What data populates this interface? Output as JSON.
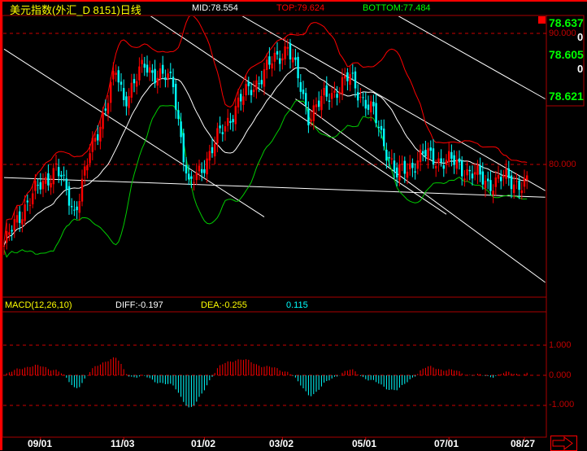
{
  "header": {
    "title": "美元指数(外汇_D 8151)日线",
    "mid": "MID:78.554",
    "top": "TOP:79.624",
    "bottom": "BOTTOM:77.484"
  },
  "right_panel": {
    "v1": "78.637",
    "z1": "0",
    "v2": "78.605",
    "z2": "0",
    "v3": "78.621"
  },
  "colors": {
    "up": "#ff0000",
    "down": "#00ffff",
    "mid": "#ffffff",
    "upper": "#ff0000",
    "lower": "#00cc00",
    "dea": "#ffff00"
  },
  "macd_header": {
    "name": "MACD(12,26,10)",
    "diff": "DIFF:-0.197",
    "dea": "DEA:-0.255",
    "macd": "0.115"
  },
  "chart_data": {
    "type": "candlestick",
    "price_axis": {
      "ticks": [
        "90.000",
        "80.000"
      ],
      "tick_values": [
        90,
        80
      ]
    },
    "macd_axis": {
      "ticks": [
        "1.000",
        "0.000",
        "-1.000"
      ],
      "tick_values": [
        1,
        0,
        -1
      ]
    },
    "x_ticks": [
      {
        "label": "09/01",
        "bar": 14
      },
      {
        "label": "11/03",
        "bar": 46
      },
      {
        "label": "01/02",
        "bar": 77
      },
      {
        "label": "03/02",
        "bar": 107
      },
      {
        "label": "05/01",
        "bar": 139
      },
      {
        "label": "07/01",
        "bar": 171
      },
      {
        "label": "08/27",
        "bar": 200
      }
    ],
    "bars": 202,
    "close_keypoints": [
      [
        0,
        73.8
      ],
      [
        8,
        76.9
      ],
      [
        20,
        79.8
      ],
      [
        27,
        76.4
      ],
      [
        33,
        80.7
      ],
      [
        43,
        87.0
      ],
      [
        46,
        85.0
      ],
      [
        54,
        87.5
      ],
      [
        65,
        86.2
      ],
      [
        71,
        78.1
      ],
      [
        80,
        81.2
      ],
      [
        89,
        84.4
      ],
      [
        102,
        87.5
      ],
      [
        109,
        89.1
      ],
      [
        117,
        83.8
      ],
      [
        123,
        85.0
      ],
      [
        133,
        86.6
      ],
      [
        142,
        83.8
      ],
      [
        151,
        79.1
      ],
      [
        161,
        80.7
      ],
      [
        173,
        80.1
      ],
      [
        186,
        78.6
      ],
      [
        192,
        78.9
      ],
      [
        200,
        78.5
      ]
    ],
    "trendlines": [
      [
        [
          0,
          79.0
        ],
        [
          208,
          77.5
        ]
      ],
      [
        [
          0,
          88.8
        ],
        [
          100,
          76.0
        ]
      ],
      [
        [
          55,
          91.5
        ],
        [
          170,
          76.2
        ]
      ],
      [
        [
          90,
          91.5
        ],
        [
          208,
          78.0
        ]
      ],
      [
        [
          112,
          85.0
        ],
        [
          208,
          71.0
        ]
      ],
      [
        [
          150,
          91.5
        ],
        [
          208,
          85.0
        ]
      ]
    ]
  },
  "date_labels": [
    "09/01",
    "11/03",
    "01/02",
    "03/02",
    "05/01",
    "07/01",
    "08/27"
  ]
}
